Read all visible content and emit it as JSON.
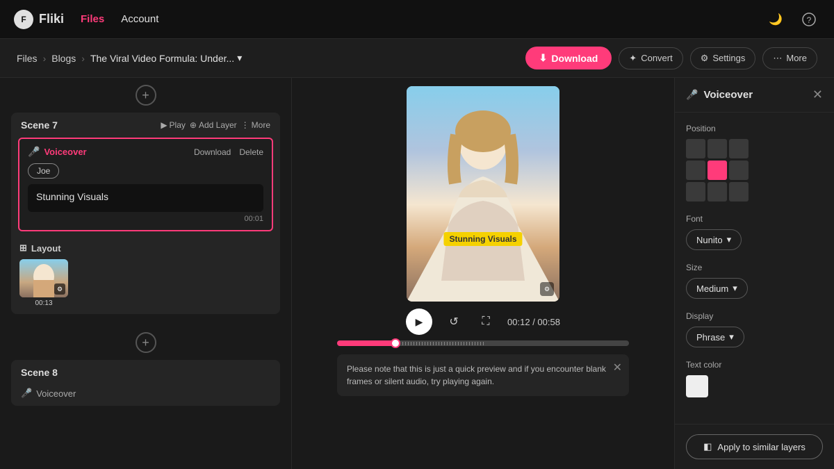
{
  "app": {
    "logo": "F",
    "name": "Fliki"
  },
  "nav": {
    "files_label": "Files",
    "account_label": "Account"
  },
  "breadcrumb": {
    "root": "Files",
    "folder": "Blogs",
    "file": "The Viral Video Formula: Under...",
    "chevron": "▾"
  },
  "toolbar": {
    "download_label": "Download",
    "download_icon": "⬇",
    "convert_label": "Convert",
    "convert_icon": "✦",
    "settings_label": "Settings",
    "settings_icon": "⚙",
    "more_label": "More",
    "more_icon": "⋯"
  },
  "scene7": {
    "title": "Scene 7",
    "play_label": "Play",
    "play_icon": "▶",
    "add_layer_label": "Add Layer",
    "add_layer_icon": "⊕",
    "more_label": "More",
    "more_icon": "⋮",
    "voiceover": {
      "title": "Voiceover",
      "mic_icon": "🎤",
      "download_label": "Download",
      "delete_label": "Delete",
      "voice_name": "Joe",
      "text": "Stunning Visuals",
      "time": "00:01"
    },
    "layout": {
      "title": "Layout",
      "icon": "⊞",
      "thumb_time": "00:13"
    }
  },
  "scene8": {
    "title": "Scene 8",
    "voiceover_label": "Voiceover",
    "mic_icon": "🎤"
  },
  "video": {
    "subtitle_text": "Stunning Visuals",
    "play_icon": "▶",
    "replay_icon": "↺",
    "fullscreen_icon": "⛶",
    "time_current": "00:12",
    "time_total": "00:58",
    "progress_pct": 20
  },
  "notice": {
    "text": "Please note that this is just a quick preview and if you encounter blank frames or silent audio, try playing again.",
    "close_icon": "✕"
  },
  "right_panel": {
    "title": "Voiceover",
    "mic_icon": "🎤",
    "close_icon": "✕",
    "position_label": "Position",
    "font_label": "Font",
    "font_value": "Nunito",
    "font_chevron": "▾",
    "size_label": "Size",
    "size_value": "Medium",
    "size_chevron": "▾",
    "display_label": "Display",
    "display_value": "Phrase",
    "display_chevron": "▾",
    "text_color_label": "Text color",
    "apply_label": "Apply to similar layers",
    "apply_icon": "◧"
  }
}
